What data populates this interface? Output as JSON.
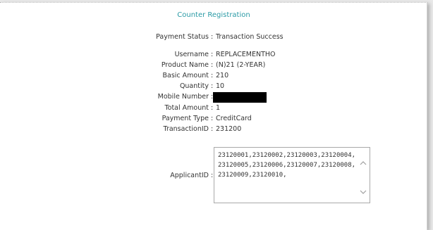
{
  "title": "Counter Registration",
  "fields": [
    {
      "label": "Payment Status",
      "value": "Transaction Success"
    },
    {
      "label": "Username",
      "value": "REPLACEMENTHO"
    },
    {
      "label": "Product Name",
      "value": "(N)21 (2-YEAR)"
    },
    {
      "label": "Basic Amount",
      "value": "210"
    },
    {
      "label": "Quantity",
      "value": "10"
    },
    {
      "label": "Mobile Number",
      "value": ""
    },
    {
      "label": "Total Amount",
      "value": "1"
    },
    {
      "label": "Payment Type",
      "value": "CreditCard"
    },
    {
      "label": "TransactionID",
      "value": "231200"
    }
  ],
  "applicant": {
    "label": "ApplicantID",
    "value": "23120001,23120002,23120003,23120004,23120005,23120006,23120007,23120008,23120009,23120010,"
  },
  "icons": {
    "scroll_up": "chevron-up-icon",
    "scroll_down": "chevron-down-icon"
  }
}
